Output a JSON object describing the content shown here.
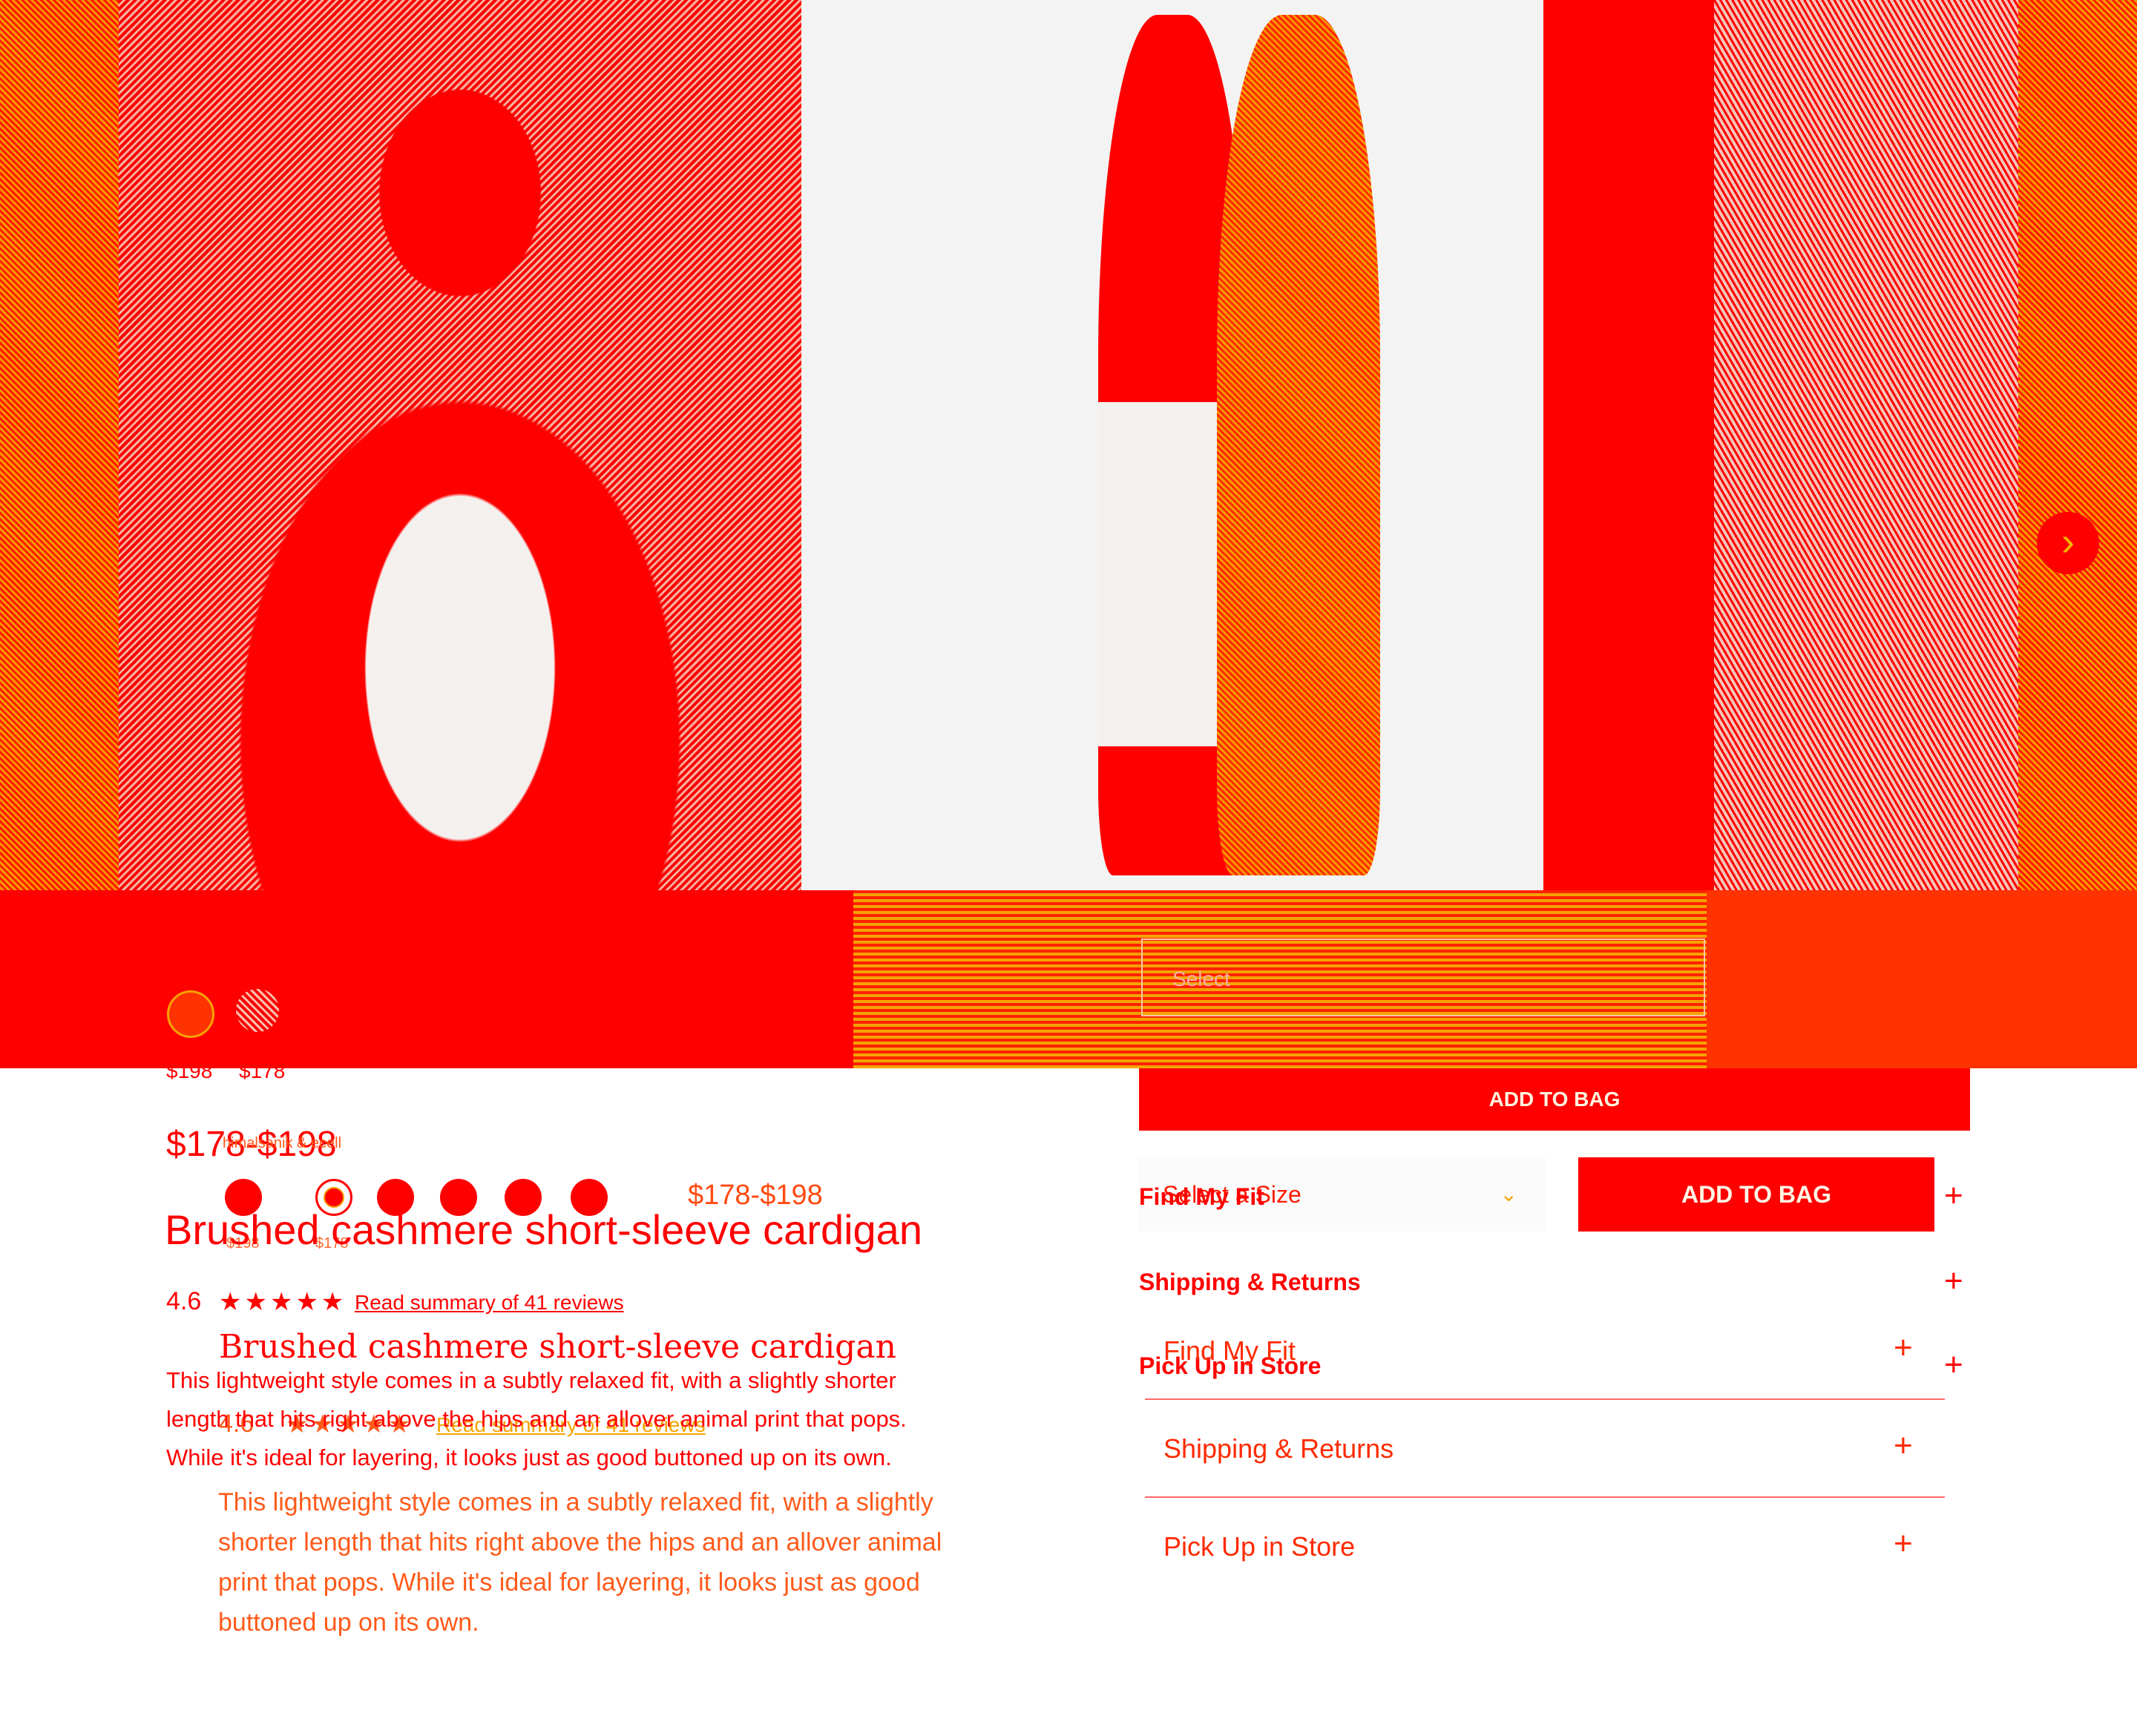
{
  "gallery": {
    "next_icon": "chevron-right-icon",
    "select_ghost": "Select"
  },
  "prices_small": {
    "original": "$198",
    "sale": "$178"
  },
  "price_overlap": "$178-$198",
  "swatch_caption": "himalsanik & ecell",
  "price_range": "$178-$198",
  "swatch_tiny": {
    "a": "$198",
    "b": "$178"
  },
  "product": {
    "title": "Brushed cashmere short-sleeve cardigan",
    "title_serif": "Brushed cashmere short-sleeve cardigan",
    "rating": "4.6",
    "rating_echo": "4.6",
    "reviews_link": "Read summary of 41 reviews",
    "reviews_link_echo": "Read summary of 41 reviews",
    "description": "This lightweight style comes in a subtly relaxed fit, with a slightly shorter length that hits right above the hips and an allover animal print that pops. While it's ideal for layering, it looks just as good buttoned up on its own.",
    "description_echo": "This lightweight style comes in a subtly relaxed fit, with a slightly shorter length that hits right above the hips and an allover animal print that pops. While it's ideal for layering, it looks just as good buttoned up on its own."
  },
  "purchase": {
    "add_to_bag_wide": "ADD TO BAG",
    "select_size": "Select a Size",
    "add_to_bag": "ADD TO BAG",
    "plus_icon": "plus-icon"
  },
  "accordion": [
    "Find My Fit",
    "Shipping & Returns",
    "Pick Up in Store"
  ],
  "accordion_echo": [
    "Find My Fit",
    "Shipping & Returns",
    "Pick Up in Store"
  ],
  "colors": {
    "accent": "#ff0000",
    "secondary": "#f5a300",
    "background": "#ffffff"
  }
}
